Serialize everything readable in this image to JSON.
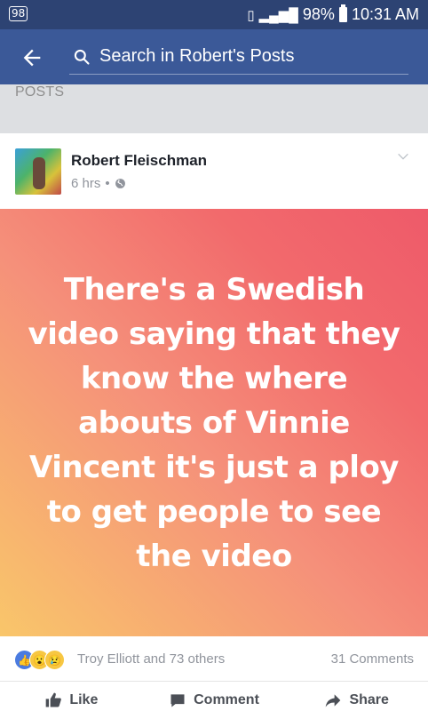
{
  "status_bar": {
    "notification_badge": "98",
    "battery": "98%",
    "time": "10:31 AM"
  },
  "app_bar": {
    "search_placeholder": "Search in Robert's Posts"
  },
  "section": {
    "label": "POSTS"
  },
  "post": {
    "author": "Robert Fleischman",
    "time_ago": "6 hrs",
    "separator": "•",
    "privacy_icon": "globe-icon",
    "text": "There's a Swedish video saying that they know the where abouts of Vinnie Vincent it's just a ploy to get people to see the video",
    "reactions_names": "Troy Elliott and 73 others",
    "comments_count": "31 Comments",
    "actions": {
      "like": "Like",
      "comment": "Comment",
      "share": "Share"
    }
  },
  "colors": {
    "status_bar": "#2d4373",
    "app_bar": "#3b5998",
    "gradient_start": "#f9c66a",
    "gradient_end": "#ee5a6a"
  }
}
